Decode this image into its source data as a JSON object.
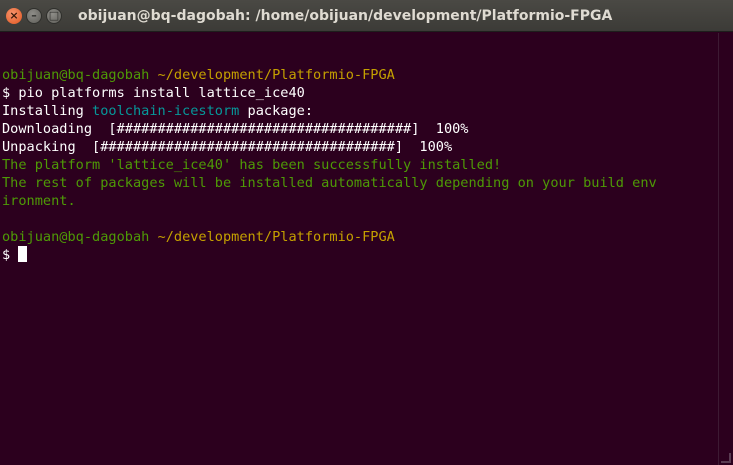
{
  "window": {
    "title": "obijuan@bq-dagobah: /home/obijuan/development/Platformio-FPGA",
    "controls": {
      "close": "×",
      "minimize": "–",
      "maximize": "□"
    }
  },
  "colors": {
    "background": "#2c001e",
    "prompt_user": "#4e9a06",
    "prompt_path": "#c4a000",
    "package": "#06989a",
    "success": "#4e9a06"
  },
  "terminal": {
    "prompt1_user": "obijuan@bq-dagobah",
    "prompt1_path": "~/development/Platformio-FPGA",
    "command_line": "$ pio platforms install lattice_ice40",
    "installing_prefix": "Installing ",
    "installing_package": "toolchain-icestorm",
    "installing_suffix": " package:",
    "downloading": "Downloading  [####################################]  100%",
    "unpacking": "Unpacking  [####################################]  100%",
    "success_line": "The platform 'lattice_ice40' has been successfully installed!",
    "rest_line1": "The rest of packages will be installed automatically depending on your build env",
    "rest_line2": "ironment.",
    "prompt2_user": "obijuan@bq-dagobah",
    "prompt2_path": "~/development/Platformio-FPGA",
    "final_prompt": "$ "
  }
}
